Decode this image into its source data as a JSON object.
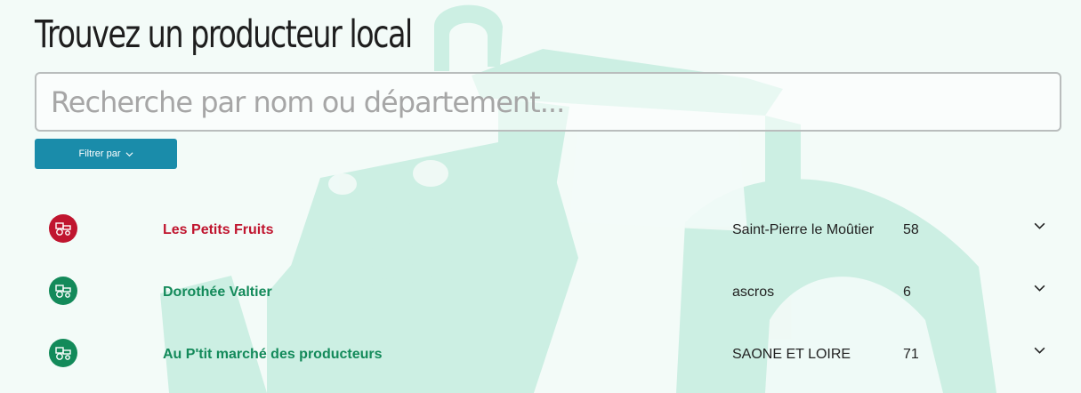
{
  "page": {
    "title": "Trouvez un producteur local"
  },
  "search": {
    "placeholder": "Recherche par nom ou département..."
  },
  "filter": {
    "label": "Filtrer par",
    "icon": "chevron-down-icon"
  },
  "colors": {
    "featured": "#c0152f",
    "standard": "#138a5a",
    "filter_button": "#1a8caa",
    "background_tractor": "#ccefe3"
  },
  "producers": [
    {
      "name": "Les Petits Fruits",
      "city": "Saint-Pierre le Moûtier",
      "department": "58",
      "icon": "tractor-icon",
      "status": "featured"
    },
    {
      "name": "Dorothée Valtier",
      "city": "ascros",
      "department": "6",
      "icon": "tractor-icon",
      "status": "standard"
    },
    {
      "name": "Au P'tit marché des producteurs",
      "city": "SAONE ET LOIRE",
      "department": "71",
      "icon": "tractor-icon",
      "status": "standard"
    }
  ]
}
